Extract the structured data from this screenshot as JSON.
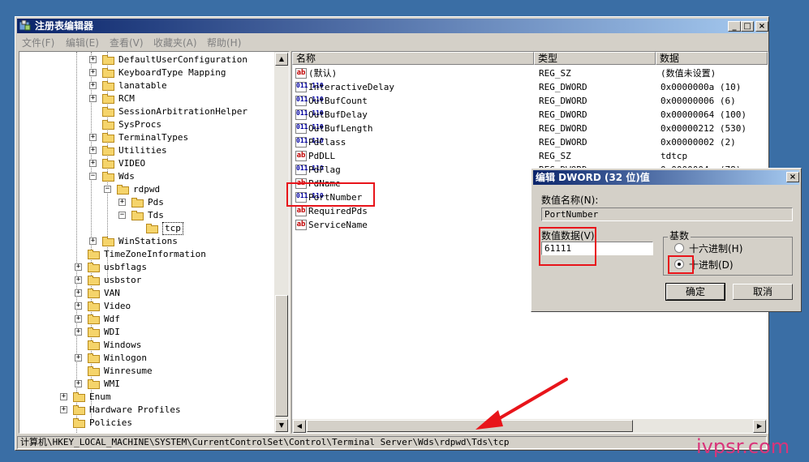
{
  "window": {
    "title": "注册表编辑器",
    "controls": {
      "minimize": "_",
      "maximize": "□",
      "close": "×"
    }
  },
  "menu": [
    {
      "label": "文件(F)"
    },
    {
      "label": "编辑(E)"
    },
    {
      "label": "查看(V)"
    },
    {
      "label": "收藏夹(A)"
    },
    {
      "label": "帮助(H)"
    }
  ],
  "tree": {
    "items": [
      {
        "label": "DefaultUserConfiguration",
        "expander": "+"
      },
      {
        "label": "KeyboardType Mapping",
        "expander": "+"
      },
      {
        "label": "lanatable",
        "expander": "+"
      },
      {
        "label": "RCM",
        "expander": "+"
      },
      {
        "label": "SessionArbitrationHelper",
        "expander": ""
      },
      {
        "label": "SysProcs",
        "expander": ""
      },
      {
        "label": "TerminalTypes",
        "expander": "+"
      },
      {
        "label": "Utilities",
        "expander": "+"
      },
      {
        "label": "VIDEO",
        "expander": "+"
      },
      {
        "label": "Wds",
        "expander": "−"
      },
      {
        "label": "rdpwd",
        "expander": "−"
      },
      {
        "label": "Pds",
        "expander": "+"
      },
      {
        "label": "Tds",
        "expander": "−"
      },
      {
        "label": "tcp",
        "expander": ""
      },
      {
        "label": "WinStations",
        "expander": "+"
      },
      {
        "label": "TimeZoneInformation",
        "expander": ""
      },
      {
        "label": "usbflags",
        "expander": "+"
      },
      {
        "label": "usbstor",
        "expander": "+"
      },
      {
        "label": "VAN",
        "expander": "+"
      },
      {
        "label": "Video",
        "expander": "+"
      },
      {
        "label": "Wdf",
        "expander": "+"
      },
      {
        "label": "WDI",
        "expander": "+"
      },
      {
        "label": "Windows",
        "expander": ""
      },
      {
        "label": "Winlogon",
        "expander": "+"
      },
      {
        "label": "Winresume",
        "expander": ""
      },
      {
        "label": "WMI",
        "expander": "+"
      },
      {
        "label": "Enum",
        "expander": "+"
      },
      {
        "label": "Hardware Profiles",
        "expander": "+"
      },
      {
        "label": "Policies",
        "expander": ""
      }
    ]
  },
  "list": {
    "columns": {
      "name": "名称",
      "type": "类型",
      "data": "数据"
    },
    "rows": [
      {
        "icon": "ab",
        "name": "(默认)",
        "type": "REG_SZ",
        "data": "(数值未设置)"
      },
      {
        "icon": "dword",
        "name": "InteractiveDelay",
        "type": "REG_DWORD",
        "data": "0x0000000a (10)"
      },
      {
        "icon": "dword",
        "name": "OutBufCount",
        "type": "REG_DWORD",
        "data": "0x00000006 (6)"
      },
      {
        "icon": "dword",
        "name": "OutBufDelay",
        "type": "REG_DWORD",
        "data": "0x00000064 (100)"
      },
      {
        "icon": "dword",
        "name": "OutBufLength",
        "type": "REG_DWORD",
        "data": "0x00000212 (530)"
      },
      {
        "icon": "dword",
        "name": "PdClass",
        "type": "REG_DWORD",
        "data": "0x00000002 (2)"
      },
      {
        "icon": "ab",
        "name": "PdDLL",
        "type": "REG_SZ",
        "data": "tdtcp"
      },
      {
        "icon": "dword",
        "name": "PdFlag",
        "type": "REG_DWORD",
        "data": "0x0000004e (78)"
      },
      {
        "icon": "ab",
        "name": "PdName",
        "type": "",
        "data": ""
      },
      {
        "icon": "dword",
        "name": "PortNumber",
        "type": "",
        "data": ""
      },
      {
        "icon": "ab",
        "name": "RequiredPds",
        "type": "",
        "data": ""
      },
      {
        "icon": "ab",
        "name": "ServiceName",
        "type": "",
        "data": ""
      }
    ]
  },
  "icons": {
    "ab": "ab",
    "dword": "011 110"
  },
  "statusbar": {
    "path": "计算机\\HKEY_LOCAL_MACHINE\\SYSTEM\\CurrentControlSet\\Control\\Terminal Server\\Wds\\rdpwd\\Tds\\tcp"
  },
  "dialog": {
    "title": "编辑 DWORD (32 位)值",
    "close": "×",
    "value_name_label": "数值名称(N):",
    "value_name": "PortNumber",
    "value_data_label": "数值数据(V)",
    "value_data": "61111",
    "base_label": "基数",
    "hex_label": "十六进制(H)",
    "dec_label": "十进制(D)",
    "selected_base": "dec",
    "ok_label": "确定",
    "cancel_label": "取消"
  },
  "watermark": "ivpsr.com",
  "colors": {
    "annotation": "#e8141a",
    "titlebar": "#0a246a",
    "watermark": "#d9347a"
  }
}
